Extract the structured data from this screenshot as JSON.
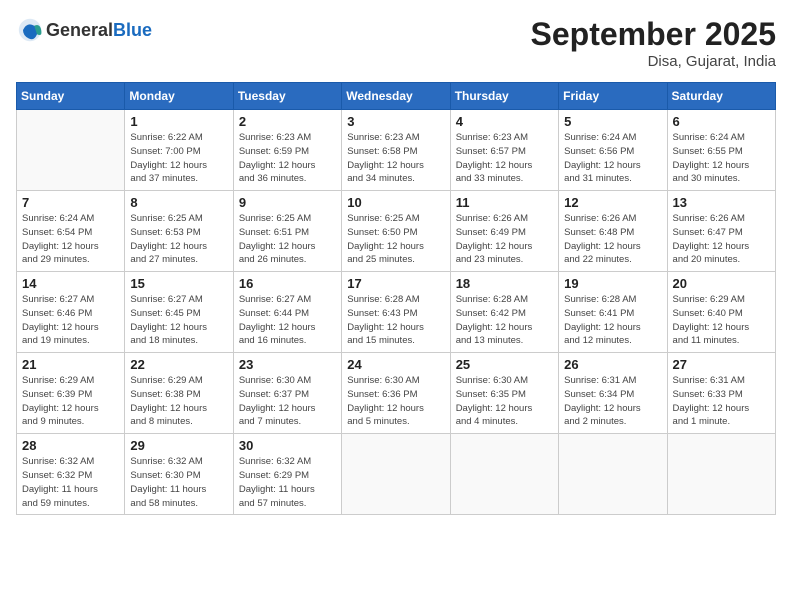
{
  "header": {
    "logo_general": "General",
    "logo_blue": "Blue",
    "month_title": "September 2025",
    "location": "Disa, Gujarat, India"
  },
  "days_of_week": [
    "Sunday",
    "Monday",
    "Tuesday",
    "Wednesday",
    "Thursday",
    "Friday",
    "Saturday"
  ],
  "weeks": [
    [
      {
        "day": "",
        "info": ""
      },
      {
        "day": "1",
        "info": "Sunrise: 6:22 AM\nSunset: 7:00 PM\nDaylight: 12 hours\nand 37 minutes."
      },
      {
        "day": "2",
        "info": "Sunrise: 6:23 AM\nSunset: 6:59 PM\nDaylight: 12 hours\nand 36 minutes."
      },
      {
        "day": "3",
        "info": "Sunrise: 6:23 AM\nSunset: 6:58 PM\nDaylight: 12 hours\nand 34 minutes."
      },
      {
        "day": "4",
        "info": "Sunrise: 6:23 AM\nSunset: 6:57 PM\nDaylight: 12 hours\nand 33 minutes."
      },
      {
        "day": "5",
        "info": "Sunrise: 6:24 AM\nSunset: 6:56 PM\nDaylight: 12 hours\nand 31 minutes."
      },
      {
        "day": "6",
        "info": "Sunrise: 6:24 AM\nSunset: 6:55 PM\nDaylight: 12 hours\nand 30 minutes."
      }
    ],
    [
      {
        "day": "7",
        "info": "Sunrise: 6:24 AM\nSunset: 6:54 PM\nDaylight: 12 hours\nand 29 minutes."
      },
      {
        "day": "8",
        "info": "Sunrise: 6:25 AM\nSunset: 6:53 PM\nDaylight: 12 hours\nand 27 minutes."
      },
      {
        "day": "9",
        "info": "Sunrise: 6:25 AM\nSunset: 6:51 PM\nDaylight: 12 hours\nand 26 minutes."
      },
      {
        "day": "10",
        "info": "Sunrise: 6:25 AM\nSunset: 6:50 PM\nDaylight: 12 hours\nand 25 minutes."
      },
      {
        "day": "11",
        "info": "Sunrise: 6:26 AM\nSunset: 6:49 PM\nDaylight: 12 hours\nand 23 minutes."
      },
      {
        "day": "12",
        "info": "Sunrise: 6:26 AM\nSunset: 6:48 PM\nDaylight: 12 hours\nand 22 minutes."
      },
      {
        "day": "13",
        "info": "Sunrise: 6:26 AM\nSunset: 6:47 PM\nDaylight: 12 hours\nand 20 minutes."
      }
    ],
    [
      {
        "day": "14",
        "info": "Sunrise: 6:27 AM\nSunset: 6:46 PM\nDaylight: 12 hours\nand 19 minutes."
      },
      {
        "day": "15",
        "info": "Sunrise: 6:27 AM\nSunset: 6:45 PM\nDaylight: 12 hours\nand 18 minutes."
      },
      {
        "day": "16",
        "info": "Sunrise: 6:27 AM\nSunset: 6:44 PM\nDaylight: 12 hours\nand 16 minutes."
      },
      {
        "day": "17",
        "info": "Sunrise: 6:28 AM\nSunset: 6:43 PM\nDaylight: 12 hours\nand 15 minutes."
      },
      {
        "day": "18",
        "info": "Sunrise: 6:28 AM\nSunset: 6:42 PM\nDaylight: 12 hours\nand 13 minutes."
      },
      {
        "day": "19",
        "info": "Sunrise: 6:28 AM\nSunset: 6:41 PM\nDaylight: 12 hours\nand 12 minutes."
      },
      {
        "day": "20",
        "info": "Sunrise: 6:29 AM\nSunset: 6:40 PM\nDaylight: 12 hours\nand 11 minutes."
      }
    ],
    [
      {
        "day": "21",
        "info": "Sunrise: 6:29 AM\nSunset: 6:39 PM\nDaylight: 12 hours\nand 9 minutes."
      },
      {
        "day": "22",
        "info": "Sunrise: 6:29 AM\nSunset: 6:38 PM\nDaylight: 12 hours\nand 8 minutes."
      },
      {
        "day": "23",
        "info": "Sunrise: 6:30 AM\nSunset: 6:37 PM\nDaylight: 12 hours\nand 7 minutes."
      },
      {
        "day": "24",
        "info": "Sunrise: 6:30 AM\nSunset: 6:36 PM\nDaylight: 12 hours\nand 5 minutes."
      },
      {
        "day": "25",
        "info": "Sunrise: 6:30 AM\nSunset: 6:35 PM\nDaylight: 12 hours\nand 4 minutes."
      },
      {
        "day": "26",
        "info": "Sunrise: 6:31 AM\nSunset: 6:34 PM\nDaylight: 12 hours\nand 2 minutes."
      },
      {
        "day": "27",
        "info": "Sunrise: 6:31 AM\nSunset: 6:33 PM\nDaylight: 12 hours\nand 1 minute."
      }
    ],
    [
      {
        "day": "28",
        "info": "Sunrise: 6:32 AM\nSunset: 6:32 PM\nDaylight: 11 hours\nand 59 minutes."
      },
      {
        "day": "29",
        "info": "Sunrise: 6:32 AM\nSunset: 6:30 PM\nDaylight: 11 hours\nand 58 minutes."
      },
      {
        "day": "30",
        "info": "Sunrise: 6:32 AM\nSunset: 6:29 PM\nDaylight: 11 hours\nand 57 minutes."
      },
      {
        "day": "",
        "info": ""
      },
      {
        "day": "",
        "info": ""
      },
      {
        "day": "",
        "info": ""
      },
      {
        "day": "",
        "info": ""
      }
    ]
  ]
}
